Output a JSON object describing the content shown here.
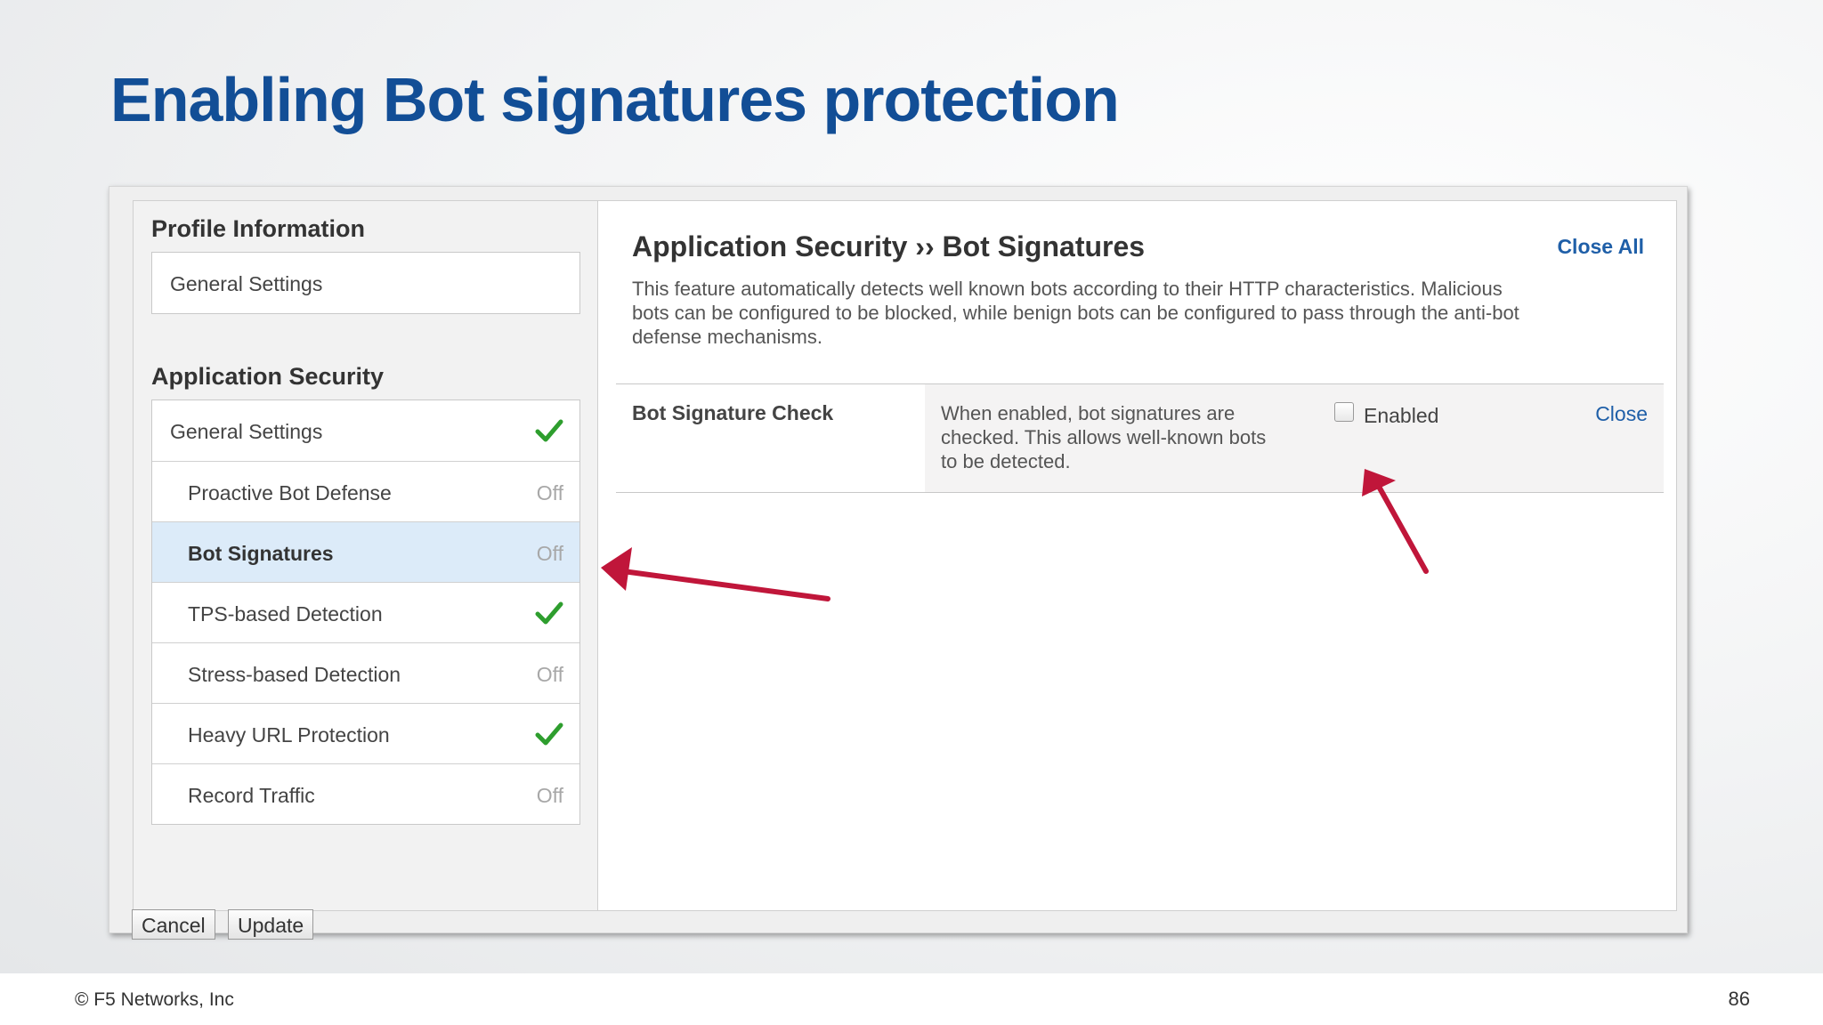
{
  "slide": {
    "title": "Enabling Bot signatures protection"
  },
  "sidebar": {
    "profile_heading": "Profile Information",
    "profile_items": [
      {
        "label": "General Settings"
      }
    ],
    "security_heading": "Application Security",
    "security_items": [
      {
        "label": "General Settings",
        "status": "check"
      },
      {
        "label": "Proactive Bot Defense",
        "status": "Off"
      },
      {
        "label": "Bot Signatures",
        "status": "Off"
      },
      {
        "label": "TPS-based Detection",
        "status": "check"
      },
      {
        "label": "Stress-based Detection",
        "status": "Off"
      },
      {
        "label": "Heavy URL Protection",
        "status": "check"
      },
      {
        "label": "Record Traffic",
        "status": "Off"
      }
    ]
  },
  "content": {
    "title": "Application Security ›› Bot Signatures",
    "close_all": "Close All",
    "description": "This feature automatically detects well known bots according to their HTTP characteristics. Malicious bots can be configured to be blocked, while benign bots can be configured to pass through the anti-bot defense mechanisms.",
    "setting": {
      "name": "Bot Signature Check",
      "help": "When enabled, bot signatures are checked. This allows well-known bots to be detected.",
      "checkbox_label": "Enabled",
      "checked": false,
      "close": "Close"
    }
  },
  "buttons": {
    "cancel": "Cancel",
    "update": "Update"
  },
  "footer": {
    "copyright": "© F5 Networks, Inc",
    "page_number": "86"
  },
  "colors": {
    "title": "#124e96",
    "link": "#1f5fa8",
    "check": "#2e9e2e",
    "arrow": "#c0163a",
    "selected_row": "#dcebf9"
  }
}
